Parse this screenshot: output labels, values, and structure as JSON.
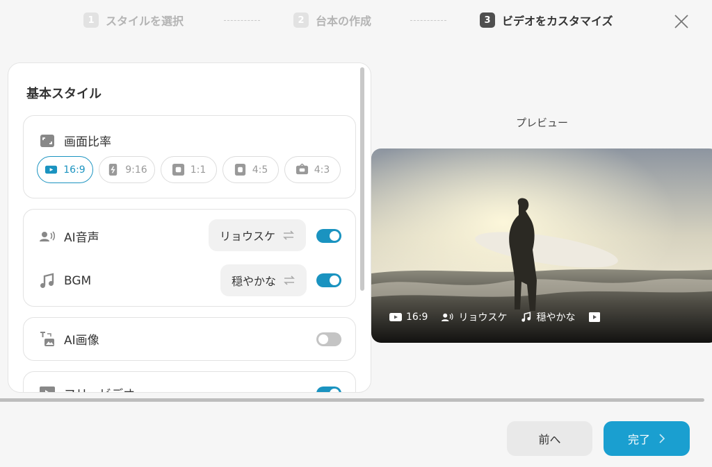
{
  "stepper": {
    "steps": [
      {
        "number": "1",
        "label": "スタイルを選択"
      },
      {
        "number": "2",
        "label": "台本の作成"
      },
      {
        "number": "3",
        "label": "ビデオをカスタマイズ"
      }
    ]
  },
  "panel": {
    "title": "基本スタイル",
    "aspect_ratio": {
      "label": "画面比率",
      "options": [
        "16:9",
        "9:16",
        "1:1",
        "4:5",
        "4:3"
      ],
      "selected": "16:9"
    },
    "ai_voice": {
      "label": "AI音声",
      "value": "リョウスケ",
      "enabled": true
    },
    "bgm": {
      "label": "BGM",
      "value": "穏やかな",
      "enabled": true
    },
    "ai_image": {
      "label": "AI画像",
      "enabled": false
    },
    "free_video": {
      "label": "フリービデオ",
      "enabled": true
    }
  },
  "preview": {
    "label": "プレビュー",
    "overlay": {
      "ratio": "16:9",
      "voice": "リョウスケ",
      "bgm": "穏やかな"
    }
  },
  "footer": {
    "prev_label": "前へ",
    "done_label": "完了"
  },
  "colors": {
    "accent": "#1a93c0",
    "primary_button": "#1a9fd0"
  }
}
